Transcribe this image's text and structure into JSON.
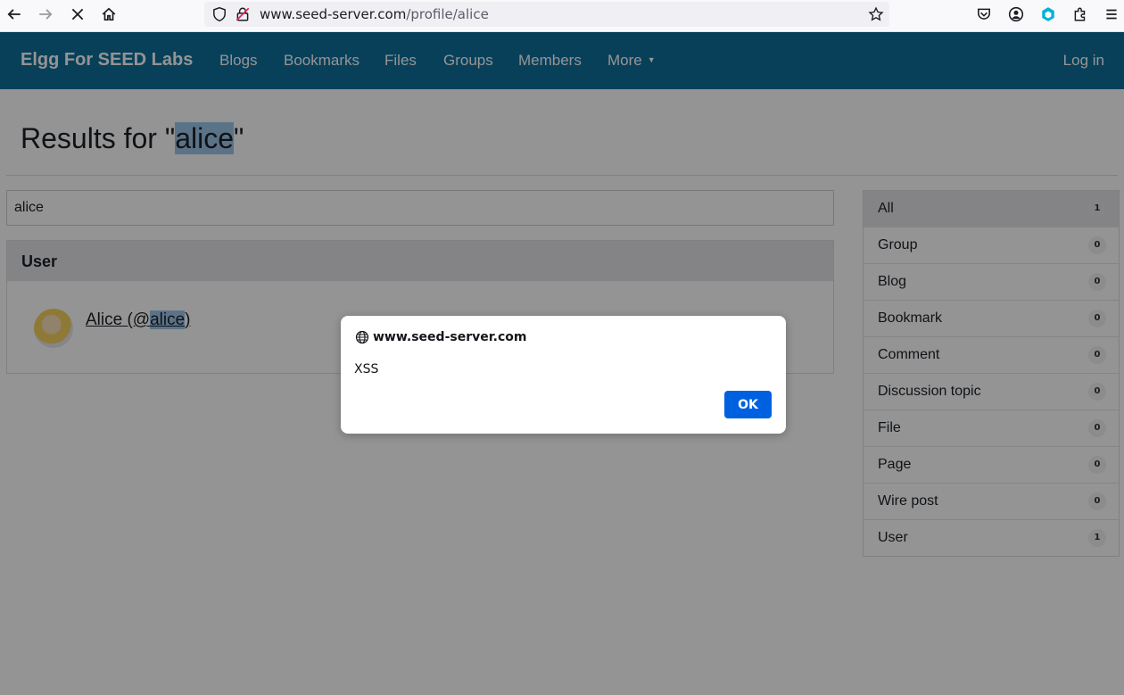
{
  "browser": {
    "url_domain": "www.seed-server.com",
    "url_path": "/profile/alice"
  },
  "site": {
    "brand": "Elgg For SEED Labs",
    "nav": [
      "Blogs",
      "Bookmarks",
      "Files",
      "Groups",
      "Members",
      "More"
    ],
    "login": "Log in"
  },
  "page": {
    "title_prefix": "Results for \"",
    "title_term": "alice",
    "title_suffix": "\"",
    "search_value": "alice"
  },
  "results": {
    "section": "User",
    "item_prefix": "Alice (@",
    "item_term": "alice",
    "item_suffix": ")"
  },
  "filters": [
    {
      "label": "All",
      "count": "1"
    },
    {
      "label": "Group",
      "count": "0"
    },
    {
      "label": "Blog",
      "count": "0"
    },
    {
      "label": "Bookmark",
      "count": "0"
    },
    {
      "label": "Comment",
      "count": "0"
    },
    {
      "label": "Discussion topic",
      "count": "0"
    },
    {
      "label": "File",
      "count": "0"
    },
    {
      "label": "Page",
      "count": "0"
    },
    {
      "label": "Wire post",
      "count": "0"
    },
    {
      "label": "User",
      "count": "1"
    }
  ],
  "dialog": {
    "origin": "www.seed-server.com",
    "message": "XSS",
    "ok": "OK"
  },
  "colors": {
    "brand_bar": "#0f6e9c",
    "ok_button": "#0061e0"
  }
}
